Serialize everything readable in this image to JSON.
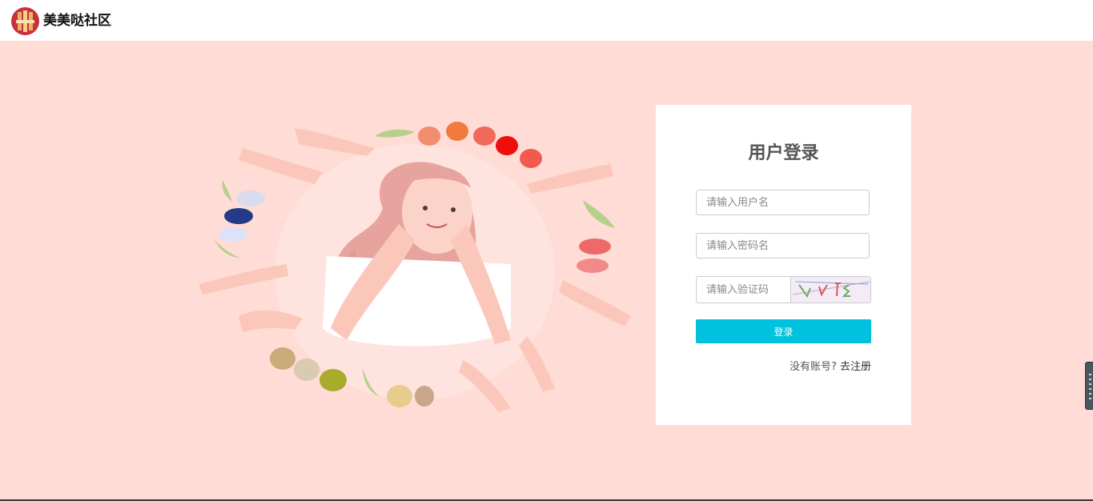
{
  "header": {
    "logo_icon": "community-logo-icon",
    "site_name": "美美哒社区"
  },
  "hero": {
    "illustration": "girl-with-nails-illustration"
  },
  "login": {
    "title": "用户登录",
    "username_placeholder": "请输入用户名",
    "password_placeholder": "请输入密码名",
    "captcha_placeholder": "请输入验证码",
    "captcha_image": "captcha-image",
    "submit_label": "登录",
    "no_account_text": "没有账号?",
    "register_link": "去注册"
  },
  "colors": {
    "page_background": "#ffdcd6",
    "accent": "#00c1de",
    "card": "#ffffff"
  }
}
